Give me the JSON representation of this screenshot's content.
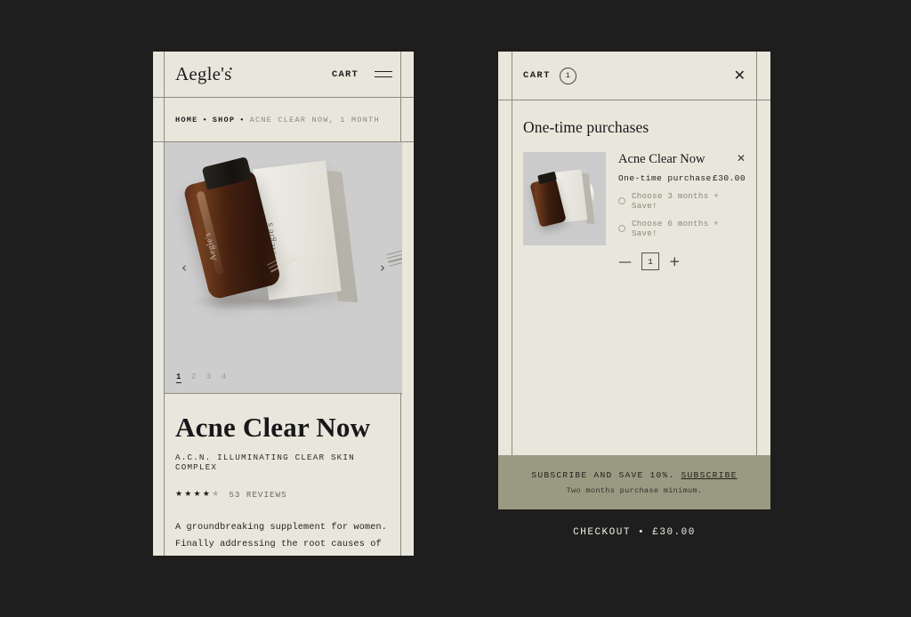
{
  "colors": {
    "page_bg": "#1e1e1e",
    "panel_bg": "#e9e7dc",
    "gallery_bg": "#cdcdcd",
    "subscribe_bg": "#9a9a82",
    "checkout_bg": "#1e1e1e",
    "ink": "#1e1e1e",
    "muted": "#8a887c"
  },
  "pdp": {
    "header": {
      "logo": "Aegle's",
      "logo_mark": "•",
      "cart_label": "CART",
      "menu_icon": "hamburger-icon"
    },
    "breadcrumb": {
      "home": "HOME",
      "shop": "SHOP",
      "current": "ACNE CLEAR NOW, 1 MONTH",
      "separator": "•"
    },
    "gallery": {
      "prev_icon": "‹",
      "next_icon": "›",
      "slides": [
        "1",
        "2",
        "3",
        "4"
      ],
      "active_slide": "1"
    },
    "product": {
      "title": "Acne Clear Now",
      "subtitle": "A.C.N. ILLUMINATING CLEAR SKIN COMPLEX",
      "stars_filled": "★★★★",
      "stars_empty": "★",
      "reviews": "53 REVIEWS",
      "description": "A groundbreaking supplement for women. Finally addressing the root causes of acne, giving you clear,"
    }
  },
  "cart": {
    "header": {
      "title": "CART",
      "count": "1",
      "close_icon": "✕"
    },
    "section_title": "One-time purchases",
    "item": {
      "name": "Acne Clear Now",
      "remove_icon": "✕",
      "purchase_label": "One-time purchase",
      "price": "£30.00",
      "options": [
        "Choose 3 months + Save!",
        "Choose 6 months + Save!"
      ],
      "qty_minus": "—",
      "qty_value": "1",
      "qty_plus": "+"
    },
    "subscribe": {
      "text": "SUBSCRIBE AND SAVE 10%.",
      "link": "SUBSCRIBE",
      "note": "Two months purchase minimum."
    },
    "checkout": {
      "label": "CHECKOUT • £30.00"
    }
  }
}
